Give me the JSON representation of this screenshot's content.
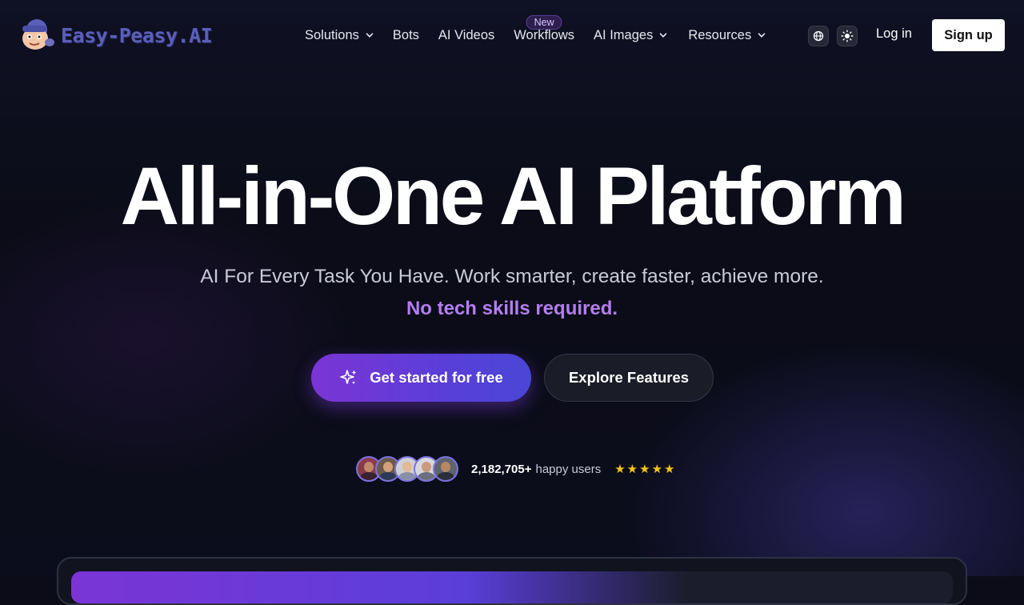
{
  "brand": {
    "name": "Easy-Peasy.AI",
    "logo_icon": "mascot-logo-icon",
    "color": "#5b5fb8"
  },
  "nav": {
    "items": [
      {
        "label": "Solutions",
        "dropdown": true
      },
      {
        "label": "Bots",
        "dropdown": false
      },
      {
        "label": "AI Videos",
        "dropdown": false
      },
      {
        "label": "Workflows",
        "dropdown": false,
        "badge": "New"
      },
      {
        "label": "AI Images",
        "dropdown": true
      },
      {
        "label": "Resources",
        "dropdown": true
      }
    ],
    "language_icon": "globe-icon",
    "theme_icon": "sun-icon",
    "login_label": "Log in",
    "signup_label": "Sign up"
  },
  "hero": {
    "title": "All-in-One AI Platform",
    "subtitle": "AI For Every Task You Have. Work smarter, create faster, achieve more.",
    "accent": "No tech skills required.",
    "accent_color": "#b47ef0",
    "cta_primary": "Get started for free",
    "cta_primary_icon": "sparkles-icon",
    "cta_secondary": "Explore Features"
  },
  "social_proof": {
    "avatar_count": 5,
    "users_count": "2,182,705+",
    "users_label": "happy users",
    "rating_stars": 5,
    "star_color": "#f5c518"
  }
}
